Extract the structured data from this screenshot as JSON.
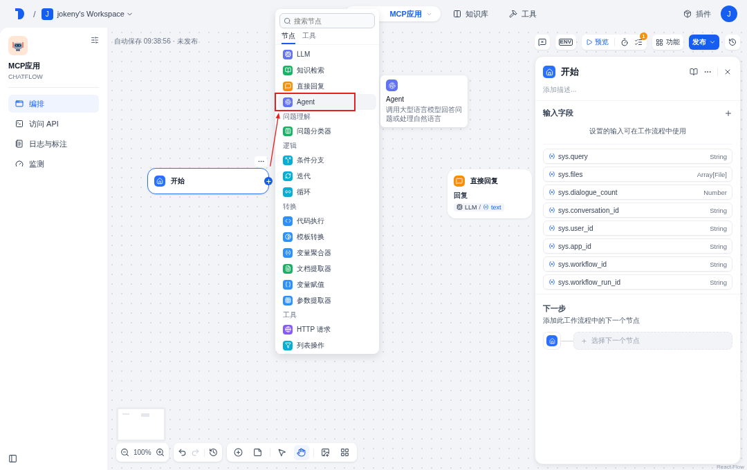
{
  "topbar": {
    "separator": "/",
    "workspace_avatar": "J",
    "workspace_name": "jokeny's Workspace",
    "nav": [
      {
        "kind": "app",
        "label": "MCP应用",
        "selected": true
      },
      {
        "kind": "knowledge",
        "label": "知识库",
        "selected": false
      },
      {
        "kind": "tools",
        "label": "工具",
        "selected": false
      }
    ],
    "plugins": "插件",
    "user_avatar": "J"
  },
  "sidebar": {
    "app_name": "MCP应用",
    "app_type": "CHATFLOW",
    "items": [
      {
        "kind": "orchestrate",
        "label": "编排",
        "selected": true
      },
      {
        "kind": "api",
        "label": "访问 API",
        "selected": false
      },
      {
        "kind": "logs",
        "label": "日志与标注",
        "selected": false
      },
      {
        "kind": "monitor",
        "label": "监测",
        "selected": false
      }
    ]
  },
  "canvas": {
    "autosave": "自动保存 09:38:56 · 未发布",
    "env_label": "ENV",
    "preview": "预览",
    "checklist_badge": "1",
    "features": "功能",
    "publish": "发布",
    "start_node": {
      "title": "开始"
    },
    "answer_node": {
      "title": "直接回复",
      "field_label": "回复",
      "source": "LLM",
      "separator": "/",
      "variable": "text"
    },
    "zoom": "100%",
    "tools": [
      {
        "kind": "add",
        "selected": false
      },
      {
        "kind": "note",
        "selected": false
      },
      {
        "kind": "pointer",
        "selected": false
      },
      {
        "kind": "hand",
        "selected": true
      },
      {
        "kind": "export",
        "selected": false
      },
      {
        "kind": "organize",
        "selected": false
      }
    ],
    "attribution": "React Flow"
  },
  "node_picker": {
    "search_placeholder": "搜索节点",
    "tabs": [
      {
        "label": "节点",
        "selected": true
      },
      {
        "label": "工具",
        "selected": false
      }
    ],
    "groups": [
      {
        "items": [
          {
            "kind": "llm",
            "label": "LLM",
            "color": "#6172f3",
            "selected": false
          },
          {
            "kind": "knowledge",
            "label": "知识检索",
            "color": "#16b364",
            "selected": false
          },
          {
            "kind": "answer",
            "label": "直接回复",
            "color": "#f79009",
            "selected": false
          },
          {
            "kind": "agent",
            "label": "Agent",
            "color": "#6172f3",
            "selected": true
          }
        ]
      },
      {
        "heading": "问题理解",
        "items": [
          {
            "kind": "classifier",
            "label": "问题分类器",
            "color": "#16b364",
            "selected": false
          }
        ]
      },
      {
        "heading": "逻辑",
        "items": [
          {
            "kind": "branch",
            "label": "条件分支",
            "color": "#06aed4",
            "selected": false
          },
          {
            "kind": "iteration",
            "label": "迭代",
            "color": "#06aed4",
            "selected": false
          },
          {
            "kind": "loop",
            "label": "循环",
            "color": "#06aed4",
            "selected": false
          }
        ]
      },
      {
        "heading": "转换",
        "items": [
          {
            "kind": "code",
            "label": "代码执行",
            "color": "#2e90fa",
            "selected": false
          },
          {
            "kind": "template",
            "label": "模板转换",
            "color": "#2e90fa",
            "selected": false
          },
          {
            "kind": "aggregator",
            "label": "变量聚合器",
            "color": "#2e90fa",
            "selected": false
          },
          {
            "kind": "document",
            "label": "文档提取器",
            "color": "#16b364",
            "selected": false
          },
          {
            "kind": "assigner",
            "label": "变量赋值",
            "color": "#2e90fa",
            "selected": false
          },
          {
            "kind": "parameter",
            "label": "参数提取器",
            "color": "#2e90fa",
            "selected": false
          }
        ]
      },
      {
        "heading": "工具",
        "items": [
          {
            "kind": "http",
            "label": "HTTP 请求",
            "color": "#875bf7",
            "selected": false
          },
          {
            "kind": "list",
            "label": "列表操作",
            "color": "#06aed4",
            "selected": false
          }
        ]
      }
    ],
    "tooltip": {
      "title": "Agent",
      "description": "调用大型语言模型回答问题或处理自然语言"
    }
  },
  "panel": {
    "title": "开始",
    "description_placeholder": "添加描述...",
    "inputs_title": "输入字段",
    "inputs_hint": "设置的输入可在工作流程中使用",
    "variables": [
      {
        "name": "sys.query",
        "type": "String"
      },
      {
        "name": "sys.files",
        "type": "Array[File]"
      },
      {
        "name": "sys.dialogue_count",
        "type": "Number"
      },
      {
        "name": "sys.conversation_id",
        "type": "String"
      },
      {
        "name": "sys.user_id",
        "type": "String"
      },
      {
        "name": "sys.app_id",
        "type": "String"
      },
      {
        "name": "sys.workflow_id",
        "type": "String"
      },
      {
        "name": "sys.workflow_run_id",
        "type": "String"
      }
    ],
    "next_title": "下一步",
    "next_hint": "添加此工作流程中的下一个节点",
    "next_placeholder": "选择下一个节点"
  }
}
